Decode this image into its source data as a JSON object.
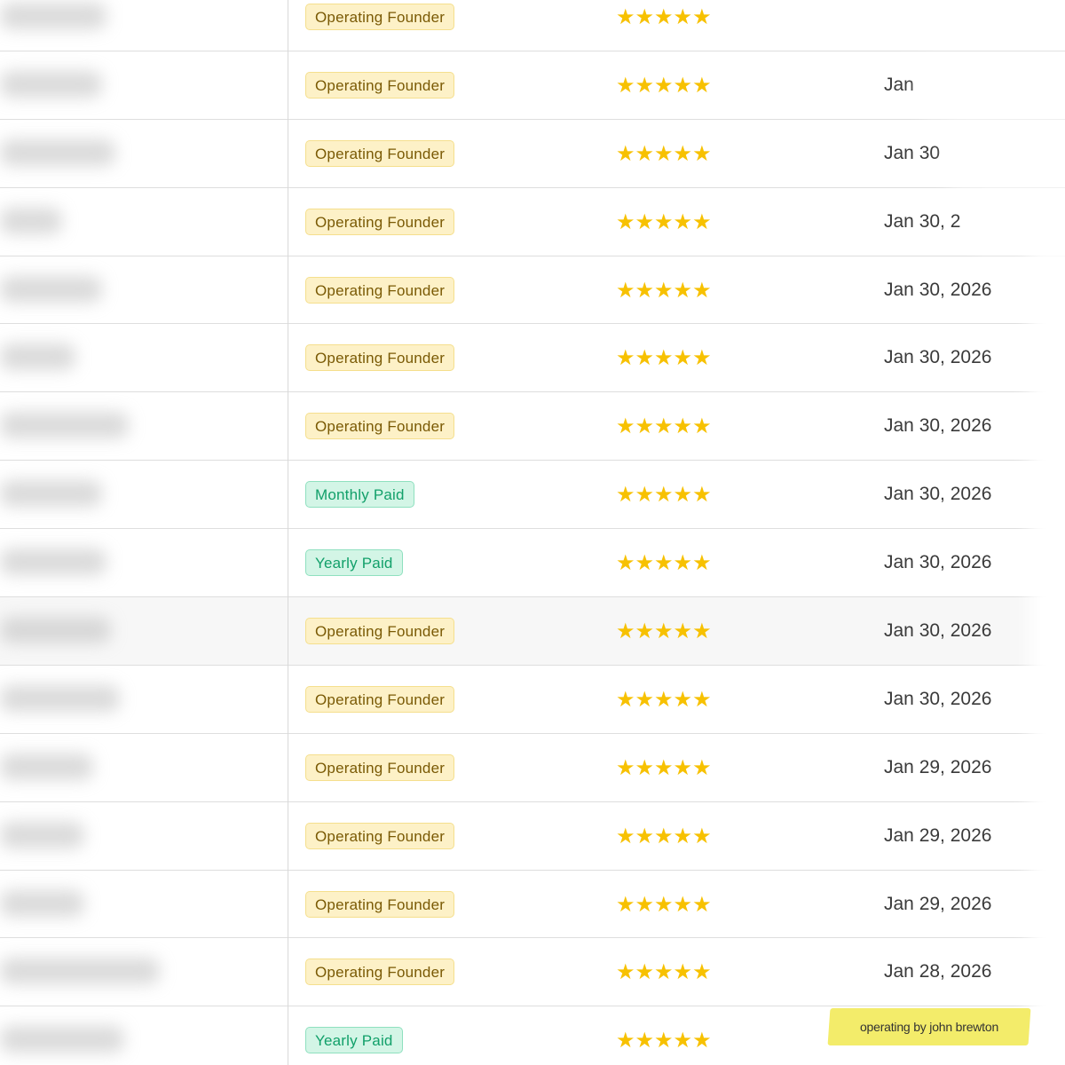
{
  "table": {
    "rows": [
      {
        "tag": "Operating Founder",
        "tag_type": "founder",
        "rating": "★★★★★",
        "date": "",
        "highlight": false
      },
      {
        "tag": "Operating Founder",
        "tag_type": "founder",
        "rating": "★★★★★",
        "date": "Jan",
        "highlight": false
      },
      {
        "tag": "Operating Founder",
        "tag_type": "founder",
        "rating": "★★★★★",
        "date": "Jan 30",
        "highlight": false
      },
      {
        "tag": "Operating Founder",
        "tag_type": "founder",
        "rating": "★★★★★",
        "date": "Jan 30, 2",
        "highlight": false
      },
      {
        "tag": "Operating Founder",
        "tag_type": "founder",
        "rating": "★★★★★",
        "date": "Jan 30, 2026",
        "highlight": false
      },
      {
        "tag": "Operating Founder",
        "tag_type": "founder",
        "rating": "★★★★★",
        "date": "Jan 30, 2026",
        "highlight": false
      },
      {
        "tag": "Operating Founder",
        "tag_type": "founder",
        "rating": "★★★★★",
        "date": "Jan 30, 2026",
        "highlight": false
      },
      {
        "tag": "Monthly Paid",
        "tag_type": "monthly",
        "rating": "★★★★★",
        "date": "Jan 30, 2026",
        "highlight": false
      },
      {
        "tag": "Yearly Paid",
        "tag_type": "yearly",
        "rating": "★★★★★",
        "date": "Jan 30, 2026",
        "highlight": false
      },
      {
        "tag": "Operating Founder",
        "tag_type": "founder",
        "rating": "★★★★★",
        "date": "Jan 30, 2026",
        "highlight": true
      },
      {
        "tag": "Operating Founder",
        "tag_type": "founder",
        "rating": "★★★★★",
        "date": "Jan 30, 2026",
        "highlight": false
      },
      {
        "tag": "Operating Founder",
        "tag_type": "founder",
        "rating": "★★★★★",
        "date": "Jan 29, 2026",
        "highlight": false
      },
      {
        "tag": "Operating Founder",
        "tag_type": "founder",
        "rating": "★★★★★",
        "date": "Jan 29, 2026",
        "highlight": false
      },
      {
        "tag": "Operating Founder",
        "tag_type": "founder",
        "rating": "★★★★★",
        "date": "Jan 29, 2026",
        "highlight": false
      },
      {
        "tag": "Operating Founder",
        "tag_type": "founder",
        "rating": "★★★★★",
        "date": "Jan 28, 2026",
        "highlight": false
      },
      {
        "tag": "Yearly Paid",
        "tag_type": "yearly",
        "rating": "★★★★★",
        "date": "",
        "highlight": false
      }
    ]
  },
  "watermark": {
    "text": "operating by john brewton"
  },
  "colors": {
    "star": "#f7c101",
    "founder_tag_bg": "#fdf1c7",
    "founder_tag_text": "#7a5a05",
    "paid_tag_bg": "#d3f5e6",
    "paid_tag_text": "#12a06a",
    "watermark_bg": "#f3ec6a"
  }
}
